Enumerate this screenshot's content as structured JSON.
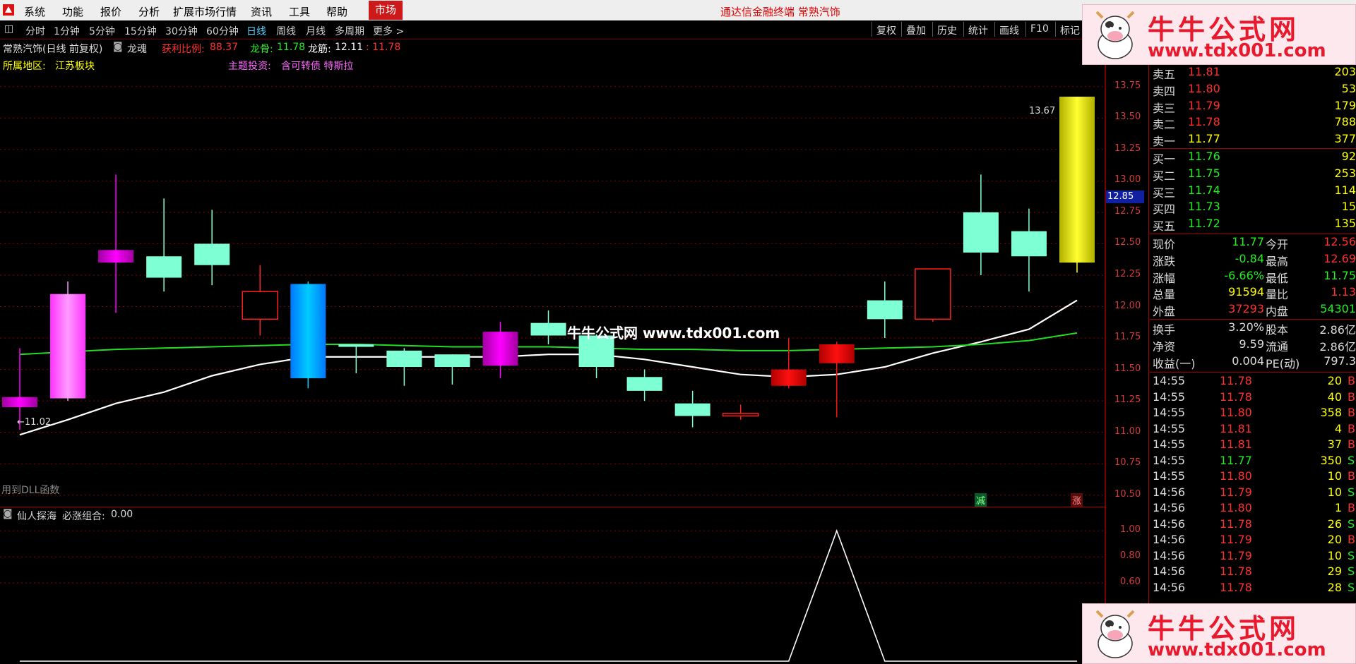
{
  "menu": {
    "items": [
      "系统",
      "功能",
      "报价",
      "分析",
      "扩展市场行情",
      "资讯",
      "工具",
      "帮助"
    ],
    "market_tab": "市场",
    "window_title": "通达信金融终端  常熟汽饰"
  },
  "toolbar": {
    "periods": [
      "分时",
      "1分钟",
      "5分钟",
      "15分钟",
      "30分钟",
      "60分钟",
      "日线",
      "周线",
      "月线",
      "多周期",
      "更多 >"
    ],
    "active_period": "日线",
    "right_buttons": [
      "复权",
      "叠加",
      "历史",
      "统计",
      "画线",
      "F10",
      "标记"
    ]
  },
  "chart_header": {
    "stock_title": "常熟汽饰(日线 前复权)",
    "indicator_name": "龙魂",
    "profit_ratio_label": "获利比例:",
    "profit_ratio_value": "88.37",
    "dragon_bone_label": "龙骨:",
    "dragon_bone_value": "11.78",
    "dragon_tendon_label": "龙筋:",
    "dragon_tendon_value": "12.11",
    "extra_value": ": 11.78",
    "region_label": "所属地区:",
    "region_value": "江苏板块",
    "theme_label": "主题投资:",
    "theme_value": "含可转债 特斯拉",
    "high_marker": "13.67",
    "low_marker": "←11.02",
    "dll_note": "用到DLL函数",
    "current_price_tag": "12.85",
    "tag_reduce": "减",
    "tag_rise": "涨"
  },
  "lower_header": {
    "indicator_name": "仙人探海",
    "combo_label": "必涨组合:",
    "combo_value": "0.00"
  },
  "colors": {
    "up": "#ff2020",
    "down": "#7fffd4",
    "ma_white": "#ffffff",
    "ma_green": "#22dd22",
    "axis": "#d43a3a",
    "grid": "#8b0000"
  },
  "chart_data": {
    "type": "candlestick",
    "y_axis_ticks": [
      "13.75",
      "13.50",
      "13.25",
      "13.00",
      "12.75",
      "12.50",
      "12.25",
      "12.00",
      "11.75",
      "11.50",
      "11.25",
      "11.00",
      "10.75",
      "10.50"
    ],
    "ylim": [
      10.42,
      13.9
    ],
    "candles": [
      {
        "o": 11.28,
        "c": 11.2,
        "h": 11.67,
        "l": 11.02,
        "color": "magenta"
      },
      {
        "o": 11.27,
        "c": 12.1,
        "h": 12.2,
        "l": 11.25,
        "color": "pink"
      },
      {
        "o": 12.45,
        "c": 12.35,
        "h": 13.05,
        "l": 11.95,
        "color": "magenta"
      },
      {
        "o": 12.4,
        "c": 12.23,
        "h": 12.86,
        "l": 12.12,
        "color": "mint"
      },
      {
        "o": 12.5,
        "c": 12.33,
        "h": 12.77,
        "l": 12.17,
        "color": "mint"
      },
      {
        "o": 11.9,
        "c": 12.12,
        "h": 12.33,
        "l": 11.77,
        "color": "red_hollow"
      },
      {
        "o": 12.18,
        "c": 11.43,
        "h": 12.2,
        "l": 11.35,
        "color": "blue"
      },
      {
        "o": 11.7,
        "c": 11.68,
        "h": 11.7,
        "l": 11.47,
        "color": "mint"
      },
      {
        "o": 11.65,
        "c": 11.52,
        "h": 11.67,
        "l": 11.37,
        "color": "mint"
      },
      {
        "o": 11.62,
        "c": 11.52,
        "h": 11.62,
        "l": 11.38,
        "color": "mint"
      },
      {
        "o": 11.8,
        "c": 11.53,
        "h": 11.88,
        "l": 11.43,
        "color": "magenta"
      },
      {
        "o": 11.87,
        "c": 11.77,
        "h": 11.97,
        "l": 11.7,
        "color": "mint"
      },
      {
        "o": 11.77,
        "c": 11.52,
        "h": 11.78,
        "l": 11.43,
        "color": "mint"
      },
      {
        "o": 11.44,
        "c": 11.33,
        "h": 11.5,
        "l": 11.25,
        "color": "mint"
      },
      {
        "o": 11.23,
        "c": 11.13,
        "h": 11.33,
        "l": 11.04,
        "color": "mint"
      },
      {
        "o": 11.13,
        "c": 11.15,
        "h": 11.22,
        "l": 11.1,
        "color": "red_hollow"
      },
      {
        "o": 11.37,
        "c": 11.5,
        "h": 11.75,
        "l": 11.35,
        "color": "red"
      },
      {
        "o": 11.55,
        "c": 11.7,
        "h": 11.72,
        "l": 11.12,
        "color": "red"
      },
      {
        "o": 11.9,
        "c": 12.05,
        "h": 12.2,
        "l": 11.75,
        "color": "mint"
      },
      {
        "o": 11.9,
        "c": 12.3,
        "h": 12.3,
        "l": 11.88,
        "color": "red_hollow"
      },
      {
        "o": 12.75,
        "c": 12.43,
        "h": 13.05,
        "l": 12.25,
        "color": "mint"
      },
      {
        "o": 12.6,
        "c": 12.4,
        "h": 12.78,
        "l": 12.12,
        "color": "mint"
      },
      {
        "o": 12.35,
        "c": 13.67,
        "h": 13.67,
        "l": 12.27,
        "color": "yellow"
      }
    ],
    "ma_white": [
      10.98,
      11.1,
      11.23,
      11.32,
      11.45,
      11.54,
      11.6,
      11.6,
      11.6,
      11.6,
      11.6,
      11.62,
      11.62,
      11.58,
      11.52,
      11.46,
      11.44,
      11.46,
      11.52,
      11.63,
      11.72,
      11.82,
      12.05
    ],
    "ma_green": [
      11.62,
      11.64,
      11.66,
      11.67,
      11.68,
      11.69,
      11.7,
      11.7,
      11.69,
      11.68,
      11.68,
      11.68,
      11.67,
      11.66,
      11.66,
      11.65,
      11.65,
      11.66,
      11.67,
      11.68,
      11.7,
      11.73,
      11.79
    ],
    "lower": {
      "y_axis_ticks": [
        "1.00",
        "0.80",
        "0.60"
      ],
      "ylim": [
        0,
        1.05
      ],
      "values": [
        0,
        0,
        0,
        0,
        0,
        0,
        0,
        0,
        0,
        0,
        0,
        0,
        0,
        0,
        0,
        0,
        0,
        1,
        0,
        0,
        0,
        0,
        0
      ]
    }
  },
  "order_book": {
    "asks": [
      {
        "label": "卖五",
        "price": "11.81",
        "vol": "203"
      },
      {
        "label": "卖四",
        "price": "11.80",
        "vol": "53"
      },
      {
        "label": "卖三",
        "price": "11.79",
        "vol": "179"
      },
      {
        "label": "卖二",
        "price": "11.78",
        "vol": "788"
      },
      {
        "label": "卖一",
        "price": "11.77",
        "vol": "377"
      }
    ],
    "bids": [
      {
        "label": "买一",
        "price": "11.76",
        "vol": "92"
      },
      {
        "label": "买二",
        "price": "11.75",
        "vol": "253"
      },
      {
        "label": "买三",
        "price": "11.74",
        "vol": "114"
      },
      {
        "label": "买四",
        "price": "11.73",
        "vol": "15"
      },
      {
        "label": "买五",
        "price": "11.72",
        "vol": "135"
      }
    ]
  },
  "quote": [
    {
      "l1": "现价",
      "v1": "11.77",
      "c1": "#22ee22",
      "l2": "今开",
      "v2": "12.56",
      "c2": "#ff3030"
    },
    {
      "l1": "涨跌",
      "v1": "-0.84",
      "c1": "#22ee22",
      "l2": "最高",
      "v2": "12.69",
      "c2": "#ff3030"
    },
    {
      "l1": "涨幅",
      "v1": "-6.66%",
      "c1": "#22ee22",
      "l2": "最低",
      "v2": "11.75",
      "c2": "#22ee22"
    },
    {
      "l1": "总量",
      "v1": "91594",
      "c1": "#ffff00",
      "l2": "量比",
      "v2": "1.13",
      "c2": "#ff3030"
    },
    {
      "l1": "外盘",
      "v1": "37293",
      "c1": "#ff3030",
      "l2": "内盘",
      "v2": "54301",
      "c2": "#22ee22"
    }
  ],
  "fundamentals": [
    {
      "l1": "换手",
      "v1": "3.20%",
      "l2": "股本",
      "v2": "2.86亿"
    },
    {
      "l1": "净资",
      "v1": "9.59",
      "l2": "流通",
      "v2": "2.86亿"
    },
    {
      "l1": "收益(一)",
      "v1": "0.004",
      "l2": "PE(动)",
      "v2": "797.3"
    }
  ],
  "trades": [
    {
      "t": "14:55",
      "p": "11.78",
      "v": "20",
      "s": "B"
    },
    {
      "t": "14:55",
      "p": "11.78",
      "v": "40",
      "s": "B"
    },
    {
      "t": "14:55",
      "p": "11.80",
      "v": "358",
      "s": "B"
    },
    {
      "t": "14:55",
      "p": "11.81",
      "v": "4",
      "s": "B"
    },
    {
      "t": "14:55",
      "p": "11.81",
      "v": "37",
      "s": "B"
    },
    {
      "t": "14:55",
      "p": "11.77",
      "v": "350",
      "s": "S"
    },
    {
      "t": "14:55",
      "p": "11.80",
      "v": "10",
      "s": "B"
    },
    {
      "t": "14:56",
      "p": "11.79",
      "v": "10",
      "s": "S"
    },
    {
      "t": "14:56",
      "p": "11.80",
      "v": "1",
      "s": "B"
    },
    {
      "t": "14:56",
      "p": "11.78",
      "v": "26",
      "s": "S"
    },
    {
      "t": "14:56",
      "p": "11.79",
      "v": "20",
      "s": "B"
    },
    {
      "t": "14:56",
      "p": "11.79",
      "v": "10",
      "s": "S"
    },
    {
      "t": "14:56",
      "p": "11.78",
      "v": "29",
      "s": "S"
    },
    {
      "t": "14:56",
      "p": "11.78",
      "v": "28",
      "s": "S"
    }
  ],
  "watermark": {
    "brand": "牛牛公式网",
    "url": "www.tdx001.com",
    "center_text": "牛牛公式网 www.tdx001.com"
  }
}
